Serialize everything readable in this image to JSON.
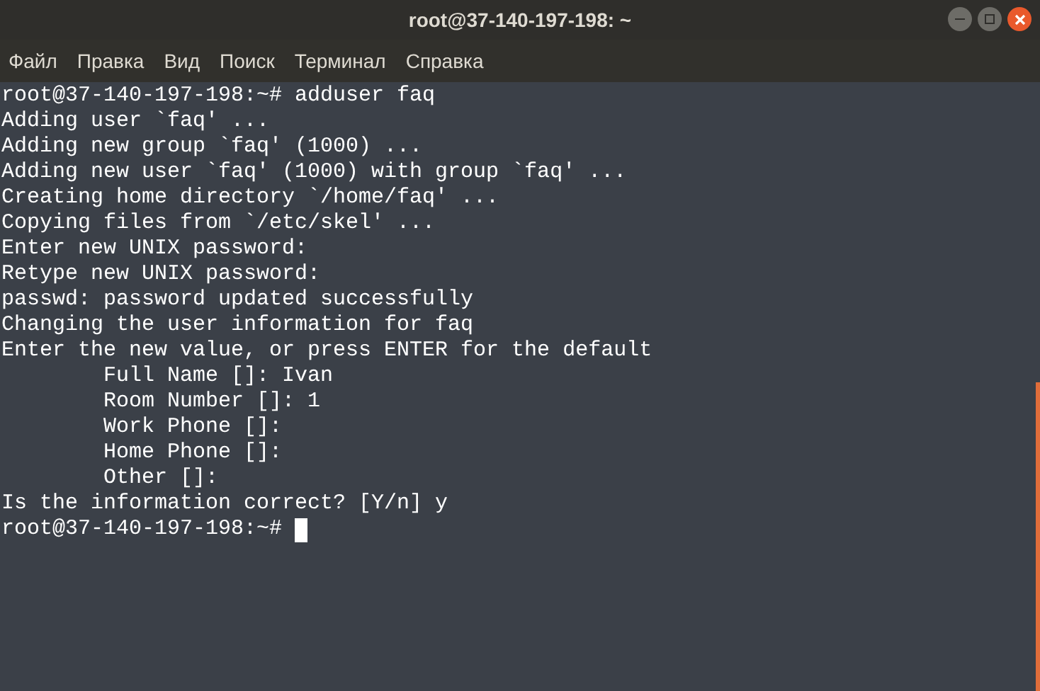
{
  "window": {
    "title": "root@37-140-197-198: ~"
  },
  "menu": [
    "Файл",
    "Правка",
    "Вид",
    "Поиск",
    "Терминал",
    "Справка"
  ],
  "terminal": {
    "lines": [
      "root@37-140-197-198:~# adduser faq",
      "Adding user `faq' ...",
      "Adding new group `faq' (1000) ...",
      "Adding new user `faq' (1000) with group `faq' ...",
      "Creating home directory `/home/faq' ...",
      "Copying files from `/etc/skel' ...",
      "Enter new UNIX password:",
      "Retype new UNIX password:",
      "passwd: password updated successfully",
      "Changing the user information for faq",
      "Enter the new value, or press ENTER for the default",
      "        Full Name []: Ivan",
      "        Room Number []: 1",
      "        Work Phone []:",
      "        Home Phone []:",
      "        Other []:",
      "Is the information correct? [Y/n] y",
      "root@37-140-197-198:~#"
    ]
  }
}
